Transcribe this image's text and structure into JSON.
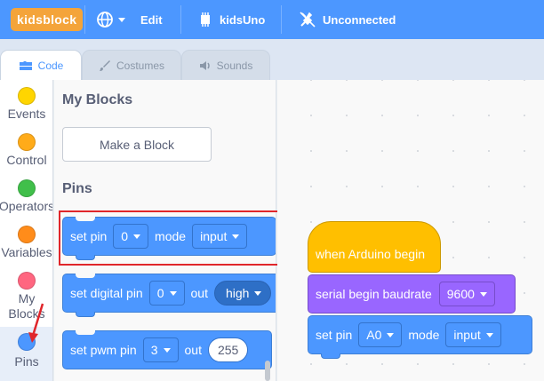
{
  "app": {
    "logo": "kidsblock"
  },
  "menubar": {
    "edit": "Edit",
    "device": "kidsUno",
    "connection": "Unconnected"
  },
  "tabs": [
    {
      "label": "Code"
    },
    {
      "label": "Costumes"
    },
    {
      "label": "Sounds"
    }
  ],
  "categories": [
    {
      "label": "Events",
      "color": "#ffd500"
    },
    {
      "label": "Control",
      "color": "#ffab19"
    },
    {
      "label": "Operators",
      "color": "#40bf4a"
    },
    {
      "label": "Variables",
      "color": "#ff8c1a"
    },
    {
      "label": "My Blocks",
      "color": "#ff6680"
    },
    {
      "label": "Pins",
      "color": "#4c97ff"
    }
  ],
  "palette": {
    "my_blocks_title": "My Blocks",
    "make_block": "Make a Block",
    "pins_title": "Pins",
    "set_pin": {
      "text1": "set pin",
      "pin": "0",
      "text2": "mode",
      "mode": "input"
    },
    "set_digital": {
      "text1": "set digital pin",
      "pin": "0",
      "text2": "out",
      "level": "high"
    },
    "set_pwm": {
      "text1": "set pwm pin",
      "pin": "3",
      "text2": "out",
      "value": "255"
    }
  },
  "workspace": {
    "hat": "when Arduino begin",
    "serial": {
      "text": "serial begin baudrate",
      "baud": "9600"
    },
    "set_pin": {
      "text1": "set pin",
      "pin": "A0",
      "text2": "mode",
      "mode": "input"
    }
  }
}
